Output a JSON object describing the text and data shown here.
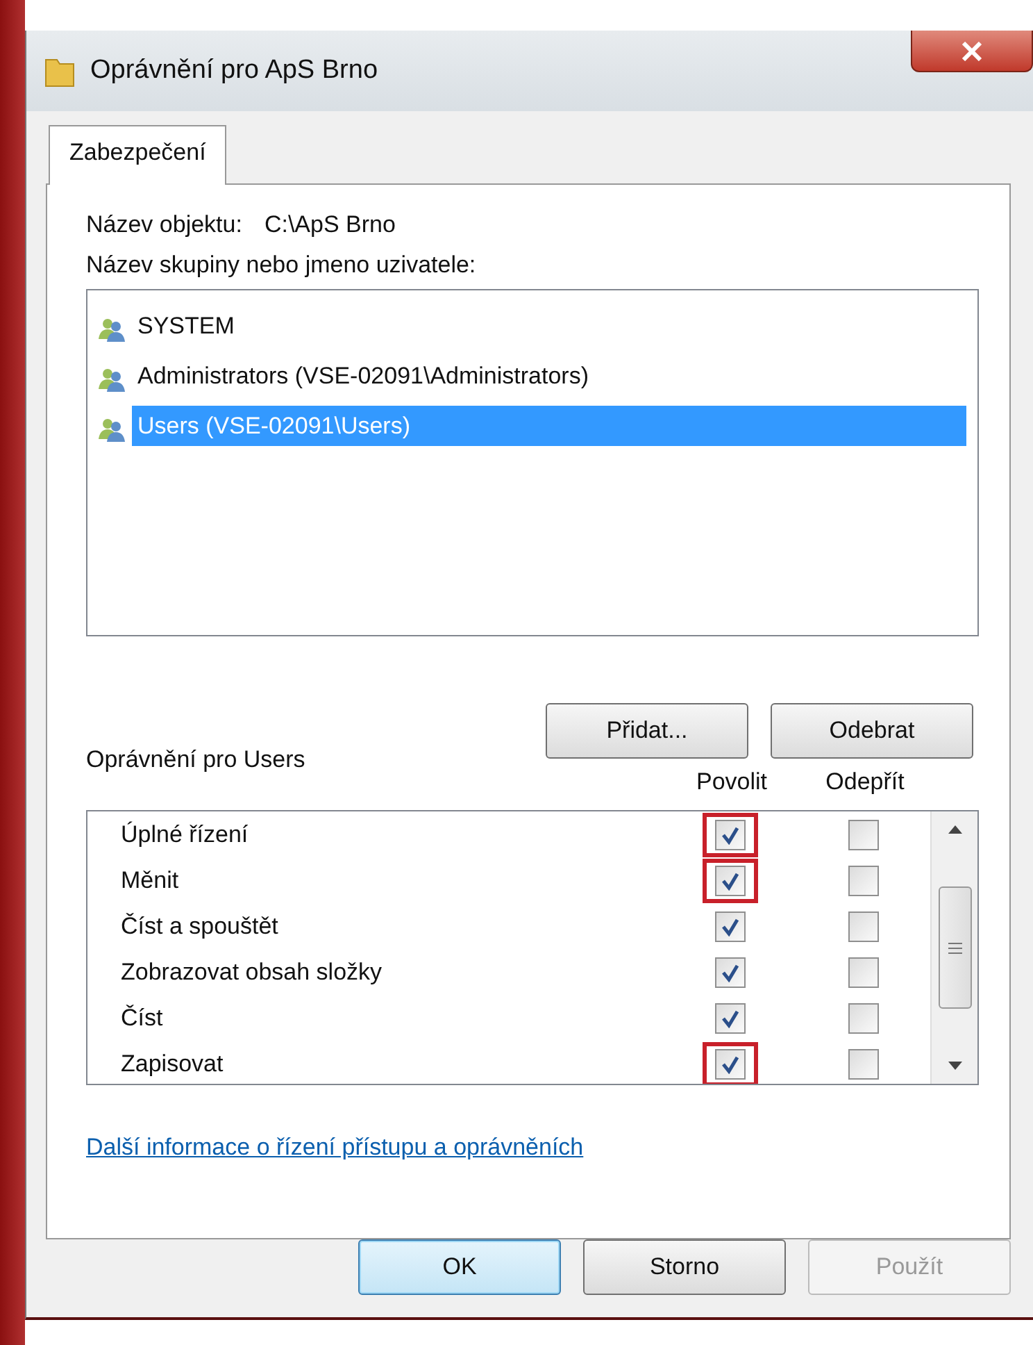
{
  "window": {
    "title": "Oprávnění pro ApS Brno"
  },
  "tabs": [
    {
      "label": "Zabezpečení",
      "selected": true
    }
  ],
  "object_name": {
    "label": "Název objektu:",
    "value": "C:\\ApS Brno"
  },
  "groups_label": "Název skupiny nebo jmeno uzivatele:",
  "groups": [
    {
      "name": "SYSTEM",
      "selected": false
    },
    {
      "name": "Administrators (VSE-02091\\Administrators)",
      "selected": false
    },
    {
      "name": "Users (VSE-02091\\Users)",
      "selected": true
    }
  ],
  "group_buttons": [
    "Přidat...",
    "Odebrat"
  ],
  "permissions_label": "Oprávnění pro Users",
  "permission_columns": [
    "Povolit",
    "Odepřít"
  ],
  "permissions": [
    {
      "name": "Úplné řízení",
      "allow": true,
      "deny": false,
      "highlighted": true
    },
    {
      "name": "Měnit",
      "allow": true,
      "deny": false,
      "highlighted": true
    },
    {
      "name": "Číst a spouštět",
      "allow": true,
      "deny": false,
      "highlighted": false
    },
    {
      "name": "Zobrazovat obsah složky",
      "allow": true,
      "deny": false,
      "highlighted": false
    },
    {
      "name": "Číst",
      "allow": true,
      "deny": false,
      "highlighted": false
    },
    {
      "name": "Zapisovat",
      "allow": true,
      "deny": false,
      "highlighted": true
    }
  ],
  "help_link": "Další informace o řízení přístupu a oprávněních",
  "buttons": [
    {
      "label": "OK",
      "kind": "default",
      "disabled": false
    },
    {
      "label": "Storno",
      "kind": "normal",
      "disabled": false
    },
    {
      "label": "Použít",
      "kind": "normal",
      "disabled": true
    }
  ]
}
